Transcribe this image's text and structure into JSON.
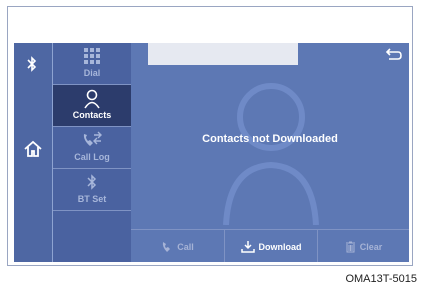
{
  "menu": {
    "items": [
      {
        "label": "Dial",
        "icon": "keypad-icon"
      },
      {
        "label": "Contacts",
        "icon": "person-icon"
      },
      {
        "label": "Call Log",
        "icon": "call-log-icon"
      },
      {
        "label": "BT Set",
        "icon": "bluetooth-icon"
      }
    ],
    "active": "Contacts"
  },
  "rail": {
    "top_icon": "bluetooth-icon",
    "home_icon": "home-icon"
  },
  "content": {
    "message": "Contacts not Downloaded",
    "back_icon": "back-arrow-icon",
    "background_icon": "person-silhouette-icon"
  },
  "bottom_bar": {
    "call_label": "Call",
    "download_label": "Download",
    "clear_label": "Clear"
  },
  "caption": "OMA13T-5015",
  "colors": {
    "screen_bg": "#5d78b4",
    "menu_bg": "#4a62a0",
    "active_item_bg": "#2c3c6c",
    "disabled_text": "#a6b3d6"
  }
}
